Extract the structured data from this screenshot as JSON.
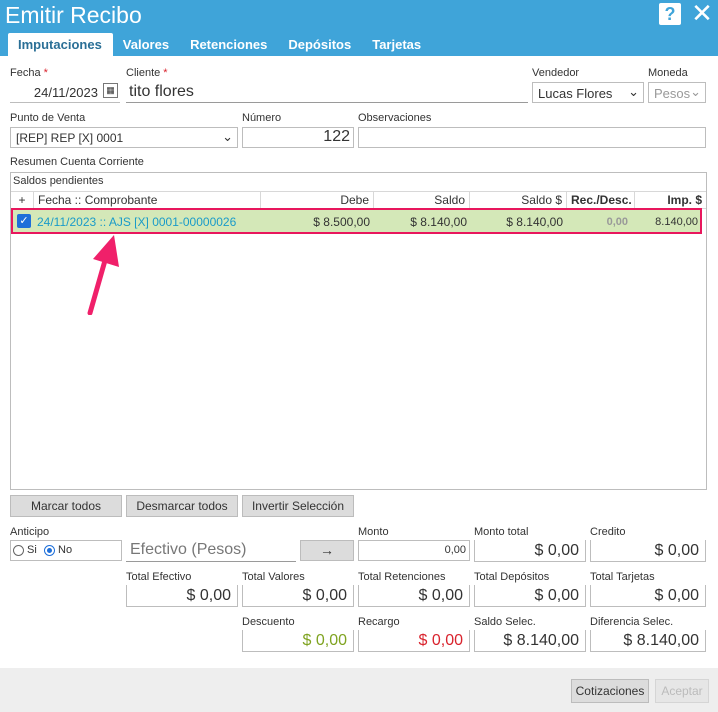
{
  "window": {
    "title": "Emitir Recibo"
  },
  "tabs": [
    "Imputaciones",
    "Valores",
    "Retenciones",
    "Depósitos",
    "Tarjetas"
  ],
  "form": {
    "fecha_label": "Fecha",
    "fecha_value": "24/11/2023",
    "cliente_label": "Cliente",
    "cliente_value": "tito flores",
    "vendedor_label": "Vendedor",
    "vendedor_value": "Lucas Flores",
    "moneda_label": "Moneda",
    "moneda_value": "Pesos",
    "punto_label": "Punto de Venta",
    "punto_value": "[REP] REP [X] 0001",
    "numero_label": "Número",
    "numero_value": "122",
    "obs_label": "Observaciones",
    "obs_value": "",
    "resumen_label": "Resumen Cuenta Corriente"
  },
  "grid": {
    "title": "Saldos pendientes",
    "columns": [
      "+",
      "Fecha :: Comprobante",
      "Debe",
      "Saldo",
      "Saldo $",
      "Rec./Desc.",
      "Imp. $"
    ],
    "rows": [
      {
        "checked": true,
        "comprobante": "24/11/2023 :: AJS [X] 0001-00000026",
        "debe": "$ 8.500,00",
        "saldo": "$ 8.140,00",
        "saldo_pesos": "$ 8.140,00",
        "rec_desc": "0,00",
        "imp": "8.140,00"
      }
    ]
  },
  "buttons": {
    "marcar": "Marcar todos",
    "desmarcar": "Desmarcar todos",
    "invertir": "Invertir Selección",
    "transfer": "→",
    "cotizaciones": "Cotizaciones",
    "aceptar": "Aceptar"
  },
  "anticipo": {
    "label": "Anticipo",
    "si": "Si",
    "no": "No",
    "selected": "No",
    "efectivo_placeholder": "Efectivo (Pesos)"
  },
  "monto": {
    "label": "Monto",
    "value": "0,00"
  },
  "totals": {
    "monto_total": {
      "label": "Monto total",
      "value": "$ 0,00"
    },
    "credito": {
      "label": "Credito",
      "value": "$ 0,00"
    },
    "total_efectivo": {
      "label": "Total Efectivo",
      "value": "$ 0,00"
    },
    "total_valores": {
      "label": "Total Valores",
      "value": "$ 0,00"
    },
    "total_retenciones": {
      "label": "Total Retenciones",
      "value": "$ 0,00"
    },
    "total_depositos": {
      "label": "Total Depósitos",
      "value": "$ 0,00"
    },
    "total_tarjetas": {
      "label": "Total Tarjetas",
      "value": "$ 0,00"
    },
    "descuento": {
      "label": "Descuento",
      "value": "$ 0,00",
      "color": "#7fa320"
    },
    "recargo": {
      "label": "Recargo",
      "value": "$ 0,00",
      "color": "#d9232d"
    },
    "saldo_selec": {
      "label": "Saldo Selec.",
      "value": "$ 8.140,00"
    },
    "diferencia_selec": {
      "label": "Diferencia Selec.",
      "value": "$ 8.140,00"
    }
  },
  "colors": {
    "header": "#3fa4d9",
    "row_highlight": "#d4e8b8",
    "row_border": "#e8175d",
    "link_text": "#1a9bc9"
  }
}
